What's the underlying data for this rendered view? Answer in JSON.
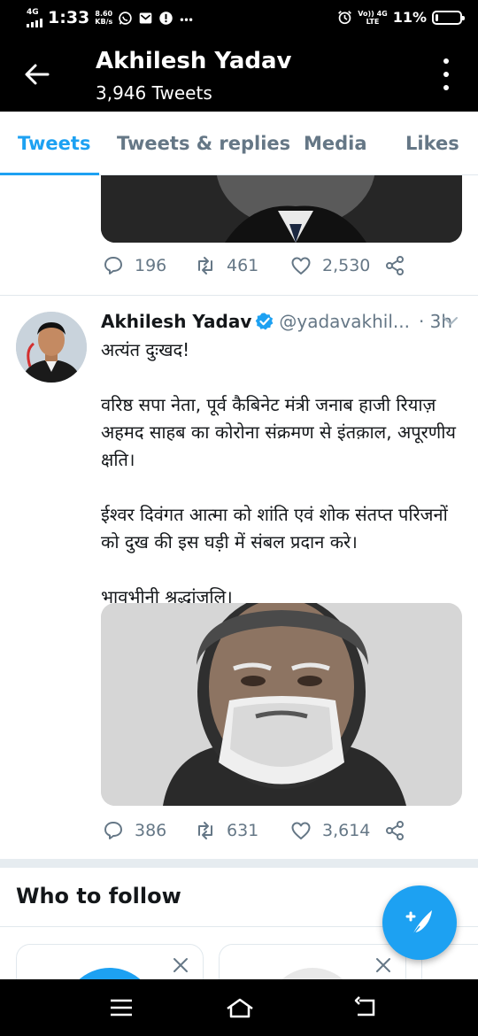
{
  "status_bar": {
    "network": "4G",
    "time": "1:33",
    "speed_value": "8.60",
    "speed_unit": "KB/s",
    "right_net_top": "Vo)) 4G",
    "right_net_bottom": "LTE",
    "battery_pct": "11%",
    "battery_level": 0.11
  },
  "header": {
    "title": "Akhilesh Yadav",
    "tweet_count": "3,946 Tweets"
  },
  "tabs": [
    {
      "label": "Tweets",
      "active": true
    },
    {
      "label": "Tweets & replies",
      "active": false
    },
    {
      "label": "Media",
      "active": false
    },
    {
      "label": "Likes",
      "active": false
    }
  ],
  "prev_tweet": {
    "replies": "196",
    "retweets": "461",
    "likes": "2,530"
  },
  "tweet": {
    "name": "Akhilesh Yadav",
    "handle": "@yadavakhil...",
    "time": "· 3h",
    "body": "अत्यंत दुःखद!\n\nवरिष्ठ सपा नेता, पूर्व  कैबिनेट मंत्री जनाब हाजी रियाज़ अहमद साहब का कोरोना संक्रमण से इंतक़ाल, अपूरणीय क्षति।\n\nईश्वर दिवंगत आत्मा को शांति एवं शोक संतप्त परिजनों को दुख की इस घड़ी में संबल प्रदान करे।\n\nभावभीनी श्रद्धांजलि।",
    "replies": "386",
    "retweets": "631",
    "likes": "3,614"
  },
  "who_to_follow": {
    "title": "Who to follow"
  },
  "colors": {
    "accent": "#1da1f2",
    "muted": "#657786",
    "text": "#14171a",
    "header_bg": "#000000"
  }
}
